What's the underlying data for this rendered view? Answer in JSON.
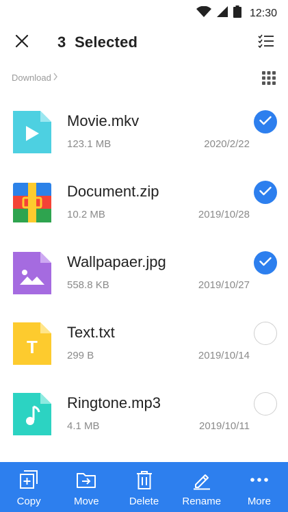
{
  "status": {
    "time": "12:30"
  },
  "header": {
    "selected_count": "3",
    "selected_label": "Selected"
  },
  "breadcrumb": {
    "folder": "Download"
  },
  "files": [
    {
      "name": "Movie.mkv",
      "size": "123.1 MB",
      "date": "2020/2/22",
      "selected": true,
      "icon": "video-file-icon",
      "color": "#4DD0E1"
    },
    {
      "name": "Document.zip",
      "size": "10.2 MB",
      "date": "2019/10/28",
      "selected": true,
      "icon": "archive-file-icon",
      "color": "#F44336"
    },
    {
      "name": "Wallpapaer.jpg",
      "size": "558.8 KB",
      "date": "2019/10/27",
      "selected": true,
      "icon": "image-file-icon",
      "color": "#A56BE0"
    },
    {
      "name": "Text.txt",
      "size": "299 B",
      "date": "2019/10/14",
      "selected": false,
      "icon": "text-file-icon",
      "color": "#FDCB2E"
    },
    {
      "name": "Ringtone.mp3",
      "size": "4.1 MB",
      "date": "2019/10/11",
      "selected": false,
      "icon": "audio-file-icon",
      "color": "#2CD3C2"
    }
  ],
  "actions": [
    {
      "label": "Copy",
      "icon": "copy-icon"
    },
    {
      "label": "Move",
      "icon": "move-icon"
    },
    {
      "label": "Delete",
      "icon": "delete-icon"
    },
    {
      "label": "Rename",
      "icon": "rename-icon"
    },
    {
      "label": "More",
      "icon": "more-icon"
    }
  ],
  "colors": {
    "accent": "#2D7FEE",
    "text": "#222222",
    "secondary": "#8A8A8A"
  }
}
